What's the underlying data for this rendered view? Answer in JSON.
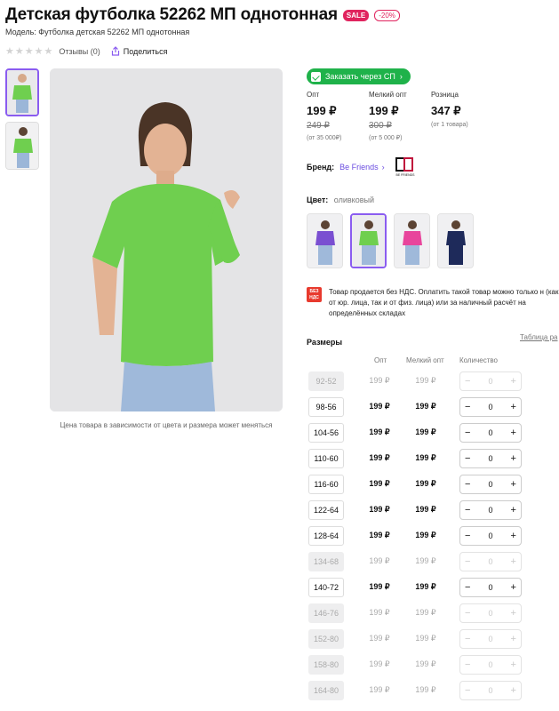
{
  "header": {
    "title": "Детская футболка 52262 МП однотонная",
    "sale_badge": "SALE",
    "discount_badge": "-20%",
    "model": "Модель: Футболка детская 52262 МП однотонная"
  },
  "rating": {
    "stars": "★★★★★",
    "reviews": "Отзывы (0)",
    "share": "Поделиться"
  },
  "photo": {
    "caption": "Цена товара в зависимости от цвета и размера может меняться"
  },
  "order_button": "Заказать через СП",
  "prices": [
    {
      "label": "Опт",
      "value": "199 ₽",
      "old": "249 ₽",
      "note": "(от 35 000₽)"
    },
    {
      "label": "Мелкий опт",
      "value": "199 ₽",
      "old": "300 ₽",
      "note": "(от 5 000 ₽)"
    },
    {
      "label": "Розница",
      "value": "347 ₽",
      "old": "",
      "note": "(от 1 товара)"
    }
  ],
  "brand": {
    "label": "Бренд:",
    "name": "Be Friends",
    "logo_text": "BE FRIENDS"
  },
  "color": {
    "label": "Цвет:",
    "value": "оливковый",
    "swatches": [
      "purple",
      "green",
      "pink",
      "navy"
    ]
  },
  "vat": {
    "icon_text": "БЕЗ НДС",
    "text": "Товар продается без НДС. Оплатить такой товар можно только н (как от юр. лица, так и от физ. лица) или за наличный расчёт на определённых складах"
  },
  "sizes": {
    "title": "Размеры",
    "table_link": "Таблица ра",
    "columns": [
      "Опт",
      "Мелкий опт",
      "Количество"
    ],
    "rows": [
      {
        "size": "92-52",
        "opt": "199 ₽",
        "small": "199 ₽",
        "qty": "0",
        "available": false
      },
      {
        "size": "98-56",
        "opt": "199 ₽",
        "small": "199 ₽",
        "qty": "0",
        "available": true
      },
      {
        "size": "104-56",
        "opt": "199 ₽",
        "small": "199 ₽",
        "qty": "0",
        "available": true
      },
      {
        "size": "110-60",
        "opt": "199 ₽",
        "small": "199 ₽",
        "qty": "0",
        "available": true
      },
      {
        "size": "116-60",
        "opt": "199 ₽",
        "small": "199 ₽",
        "qty": "0",
        "available": true
      },
      {
        "size": "122-64",
        "opt": "199 ₽",
        "small": "199 ₽",
        "qty": "0",
        "available": true
      },
      {
        "size": "128-64",
        "opt": "199 ₽",
        "small": "199 ₽",
        "qty": "0",
        "available": true
      },
      {
        "size": "134-68",
        "opt": "199 ₽",
        "small": "199 ₽",
        "qty": "0",
        "available": false
      },
      {
        "size": "140-72",
        "opt": "199 ₽",
        "small": "199 ₽",
        "qty": "0",
        "available": true
      },
      {
        "size": "146-76",
        "opt": "199 ₽",
        "small": "199 ₽",
        "qty": "0",
        "available": false
      },
      {
        "size": "152-80",
        "opt": "199 ₽",
        "small": "199 ₽",
        "qty": "0",
        "available": false
      },
      {
        "size": "158-80",
        "opt": "199 ₽",
        "small": "199 ₽",
        "qty": "0",
        "available": false
      },
      {
        "size": "164-80",
        "opt": "199 ₽",
        "small": "199 ₽",
        "qty": "0",
        "available": false
      }
    ],
    "minus": "−",
    "plus": "+"
  },
  "colors": {
    "accent": "#8a5cf0",
    "brand_link": "#6a4ce0",
    "sale": "#e0245e",
    "order_green": "#1fb24a",
    "shirt_green": "#6fcf4f"
  }
}
